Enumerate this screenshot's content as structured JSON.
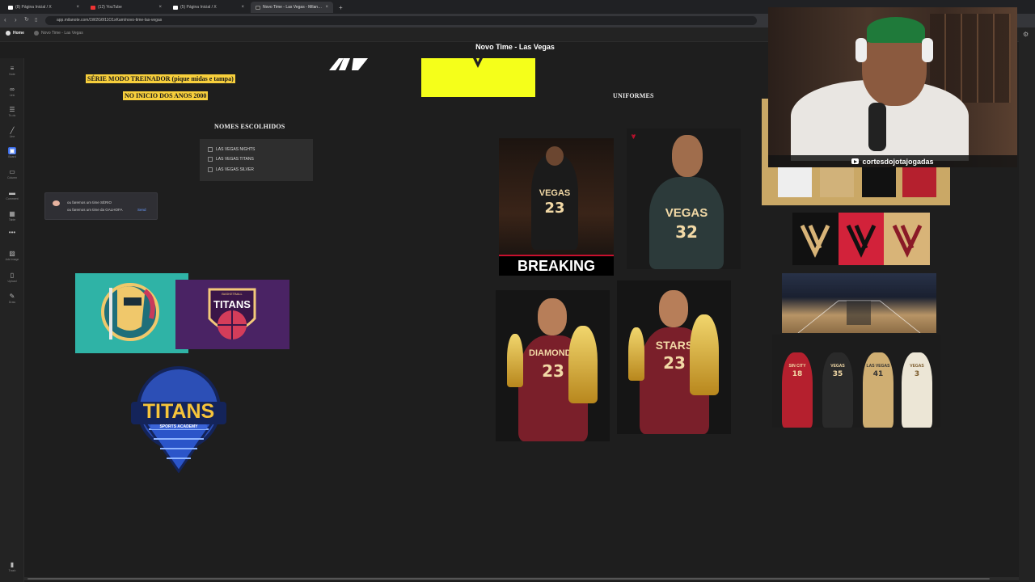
{
  "browser": {
    "tabs": [
      {
        "label": "(8) Página Inicial / X",
        "icon": "x-logo-icon"
      },
      {
        "label": "(12) YouTube",
        "icon": "youtube-icon"
      },
      {
        "label": "(5) Página Inicial / X",
        "icon": "x-logo-icon"
      },
      {
        "label": "Novo Time - Las Vegas - Milan…",
        "icon": "milanote-icon"
      }
    ],
    "url": "app.milanote.com/1W2G6f11O1xKam/novo-time-las-vegas"
  },
  "app": {
    "home_label": "Home",
    "breadcrumb": "Novo Time - Las Vegas",
    "board_title": "Novo Time - Las Vegas"
  },
  "tools": [
    {
      "label": "Note",
      "icon": "note-icon"
    },
    {
      "label": "Link",
      "icon": "link-icon"
    },
    {
      "label": "To-do",
      "icon": "todo-icon"
    },
    {
      "label": "Line",
      "icon": "line-icon"
    },
    {
      "label": "Board",
      "icon": "board-icon"
    },
    {
      "label": "Column",
      "icon": "column-icon"
    },
    {
      "label": "Comment",
      "icon": "comment-icon"
    },
    {
      "label": "Table",
      "icon": "table-icon"
    },
    {
      "label": "",
      "icon": "more-icon"
    },
    {
      "label": "Add image",
      "icon": "add-image-icon"
    },
    {
      "label": "Upload",
      "icon": "upload-icon"
    },
    {
      "label": "Draw",
      "icon": "draw-icon"
    },
    {
      "label": "Trash",
      "icon": "trash-icon"
    }
  ],
  "canvas": {
    "note_line_1": "SÉRIE MODO TREINADOR (pique midas e tampa)",
    "note_line_2": "NO INICIO DOS ANOS 2000",
    "names_heading": "NOMES ESCOLHIDOS",
    "todo_items": [
      "LAS VEGAS NIGHTS",
      "LAS VEGAS TITANS",
      "LAS VEGAS SILVER"
    ],
    "comment_lines": [
      "ou faremos um time SÉRIO",
      "ou faremos um time da GALHOFA"
    ],
    "comment_send": "Send",
    "uniforms_heading": "UNIFORMES",
    "breaking_news": "BREAKING NEWS",
    "vegas_label_1": "VEGAS",
    "vegas_num_1": "23",
    "vegas_label_2": "VEGAS",
    "vegas_num_2": "32",
    "diamonds_label": "DIAMONDS",
    "diamonds_num": "23",
    "stars_label": "STARS",
    "stars_num": "23",
    "titans_logo_1": "TITANS",
    "titans_logo_1_sub": "BASKETBALL",
    "titans_logo_2": "TITANS",
    "titans_logo_2_sub": "SPORTS ACADEMY",
    "game_jersey_labels": [
      "SIN CITY",
      "VEGAS",
      "LAS VEGAS",
      "VEGAS"
    ],
    "game_jersey_nums": [
      "18",
      "35",
      "41",
      "3"
    ]
  },
  "webcam": {
    "channel": "cortesdojotajogadas"
  },
  "colors": {
    "highlight": "#f7cf3c",
    "canvas_bg": "#1e1e1e",
    "accent": "#3c6eea",
    "yellow_block": "#f5ff1a"
  }
}
